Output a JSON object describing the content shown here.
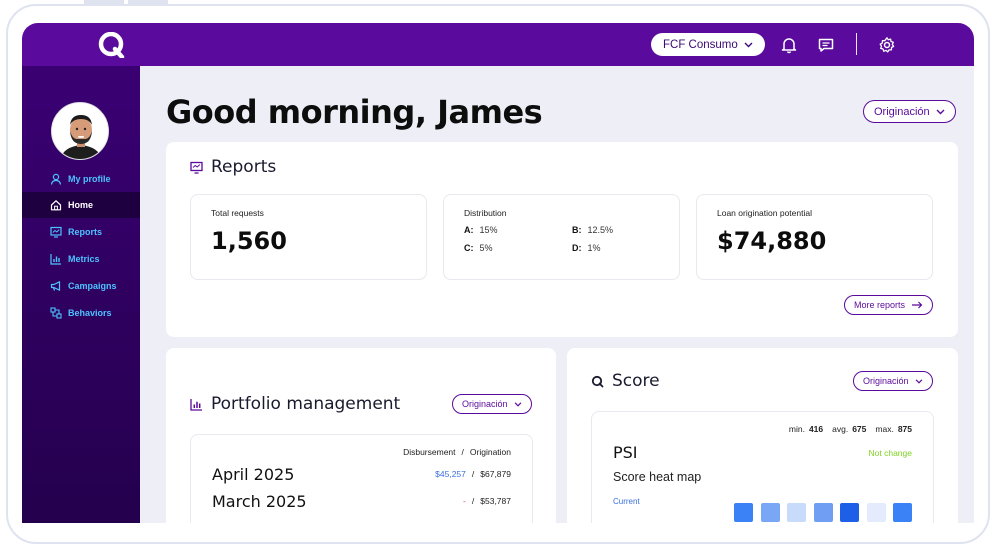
{
  "topbar": {
    "company_selector": "FCF Consumo"
  },
  "sidebar": {
    "items": [
      {
        "label": "My profile"
      },
      {
        "label": "Home"
      },
      {
        "label": "Reports"
      },
      {
        "label": "Metrics"
      },
      {
        "label": "Campaigns"
      },
      {
        "label": "Behaviors"
      }
    ]
  },
  "header": {
    "greeting": "Good morning, James",
    "filter": "Originación"
  },
  "reports": {
    "title": "Reports",
    "total_requests_label": "Total requests",
    "total_requests_value": "1,560",
    "distribution_label": "Distribution",
    "distribution": [
      {
        "grade": "A:",
        "value": "15%"
      },
      {
        "grade": "B:",
        "value": "12.5%"
      },
      {
        "grade": "C:",
        "value": "5%"
      },
      {
        "grade": "D:",
        "value": "1%"
      }
    ],
    "loan_label": "Loan origination potential",
    "loan_value": "$74,880",
    "more_button": "More reports"
  },
  "portfolio": {
    "title": "Portfolio management",
    "filter": "Originación",
    "col_disbursement": "Disbursement",
    "col_sep": "/",
    "col_origination": "Origination",
    "rows": [
      {
        "month": "April 2025",
        "disbursement": "$45,257",
        "sep": "/",
        "origination": "$67,879"
      },
      {
        "month": "March 2025",
        "disbursement": "-",
        "sep": "/",
        "origination": "$53,787"
      }
    ]
  },
  "score": {
    "title": "Score",
    "filter": "Originación",
    "min_label": "min.",
    "min_value": "416",
    "avg_label": "avg.",
    "avg_value": "675",
    "max_label": "max.",
    "max_value": "875",
    "psi_title": "PSI",
    "psi_status": "Not change",
    "heatmap_title": "Score heat map",
    "current_label": "Current",
    "heat_colors": [
      "#3b82f6",
      "#7aa7f5",
      "#c9dbfa",
      "#6f9ef2",
      "#1d5fe6",
      "#e3ebfc",
      "#3b82f6"
    ]
  },
  "colors": {
    "brand": "#5a0a9c",
    "sidebar": "#2b0059",
    "accent_cyan": "#4dc3ff",
    "positive_green": "#7ed321",
    "link_blue": "#3b6fe0"
  }
}
